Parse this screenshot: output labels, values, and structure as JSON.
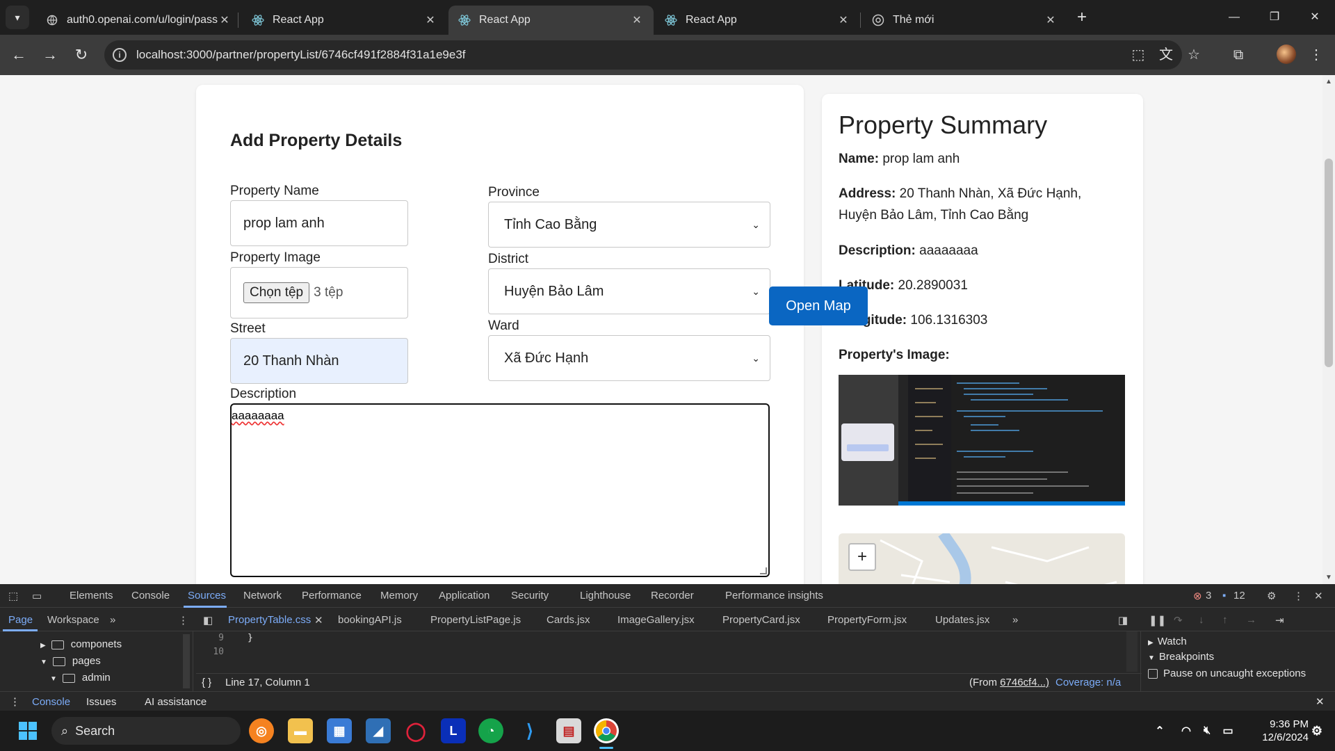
{
  "browser": {
    "tabs": [
      {
        "title": "auth0.openai.com/u/login/pass",
        "active": false
      },
      {
        "title": "React App",
        "active": false
      },
      {
        "title": "React App",
        "active": true
      },
      {
        "title": "React App",
        "active": false
      },
      {
        "title": "Thẻ mới",
        "active": false
      }
    ],
    "url": "localhost:3000/partner/propertyList/6746cf491f2884f31a1e9e3f"
  },
  "form": {
    "title": "Add Property Details",
    "property_name_label": "Property Name",
    "property_name_value": "prop lam anh",
    "property_image_label": "Property Image",
    "file_button": "Chọn tệp",
    "file_count": "3 tệp",
    "street_label": "Street",
    "street_value": "20 Thanh Nhàn",
    "description_label": "Description",
    "description_value": "aaaaaaaa",
    "province_label": "Province",
    "province_value": "Tỉnh Cao Bằng",
    "district_label": "District",
    "district_value": "Huyện Bảo Lâm",
    "ward_label": "Ward",
    "ward_value": "Xã Đức Hạnh"
  },
  "open_map_label": "Open Map",
  "summary": {
    "title": "Property Summary",
    "name_label": "Name:",
    "name_value": "prop lam anh",
    "address_label": "Address:",
    "address_value": "20 Thanh Nhàn, Xã Đức Hạnh, Huyện Bảo Lâm, Tỉnh Cao Bằng",
    "description_label": "Description:",
    "description_value": "aaaaaaaa",
    "latitude_label": "Latitude:",
    "latitude_value": "20.2890031",
    "longitude_label": "Longitude:",
    "longitude_value": "106.1316303",
    "image_label": "Property's Image:",
    "zoom_in": "+"
  },
  "devtools": {
    "tabs": [
      "Elements",
      "Console",
      "Sources",
      "Network",
      "Performance",
      "Memory",
      "Application",
      "Security",
      "Lighthouse",
      "Recorder",
      "Performance insights"
    ],
    "active_tab": "Sources",
    "errors_count": "3",
    "messages_count": "12",
    "nav_tabs": [
      "Page",
      "Workspace"
    ],
    "file_tabs": [
      "PropertyTable.css",
      "bookingAPI.js",
      "PropertyListPage.js",
      "Cards.jsx",
      "ImageGallery.jsx",
      "PropertyCard.jsx",
      "PropertyForm.jsx",
      "Updates.jsx"
    ],
    "tree": [
      "componets",
      "pages",
      "admin"
    ],
    "code_lines": [
      {
        "num": "9",
        "text": "}"
      },
      {
        "num": "10",
        "text": ""
      }
    ],
    "cursor_pos": "Line 17, Column 1",
    "from_text": "(From ",
    "from_link": "6746cf4...)",
    "coverage": "Coverage: n/a",
    "watch": "Watch",
    "breakpoints": "Breakpoints",
    "pause_label": "Pause on uncaught exceptions",
    "drawer_tabs": [
      "Console",
      "Issues",
      "AI assistance"
    ]
  },
  "taskbar": {
    "search_placeholder": "Search",
    "time": "9:36 PM",
    "date": "12/6/2024"
  },
  "colors": {
    "accent": "#0a66c2",
    "devtools_bg": "#282828",
    "chrome_bg": "#1f1f1f",
    "link": "#7cacf8"
  }
}
